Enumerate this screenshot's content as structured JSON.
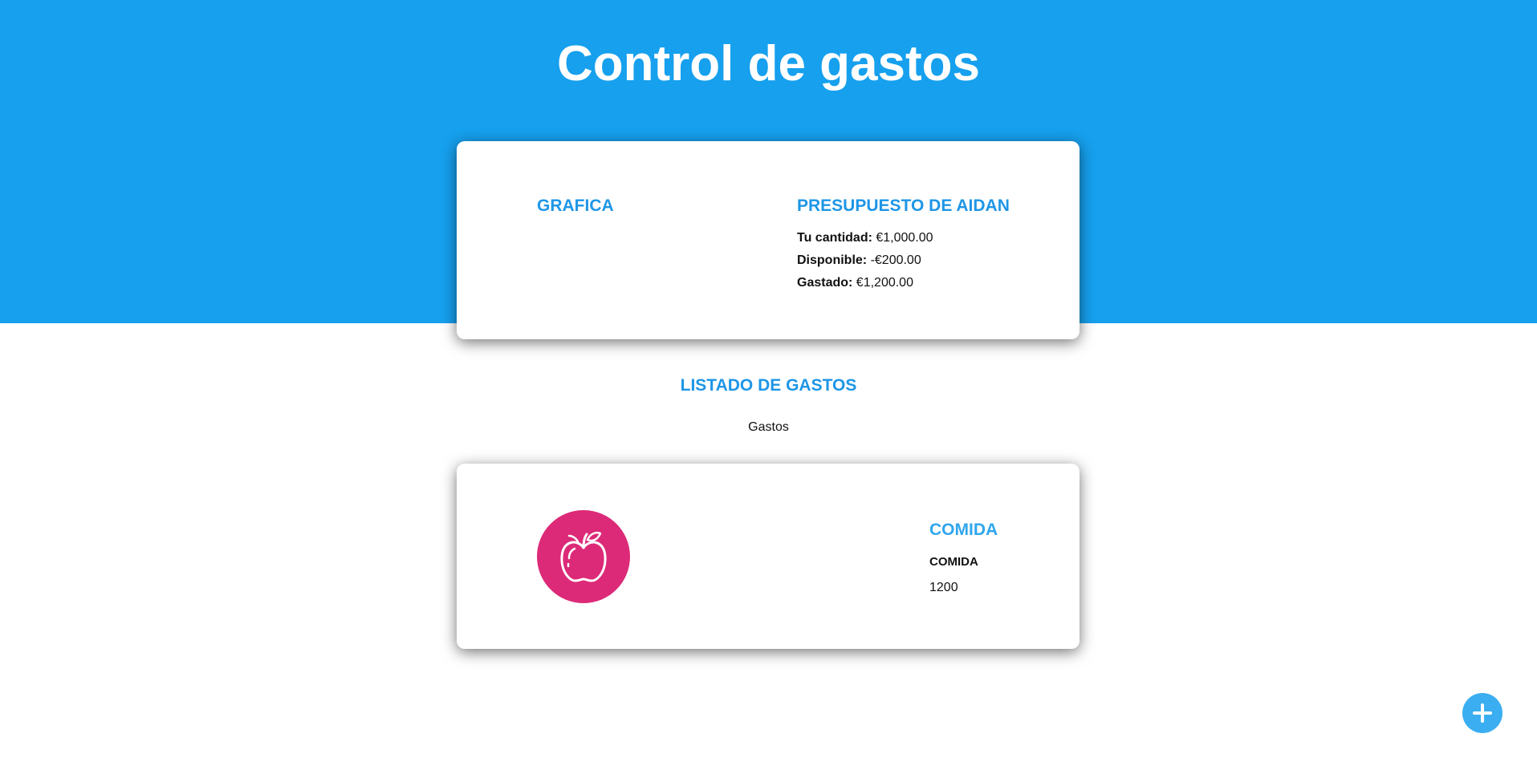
{
  "colors": {
    "header_background": "#16a0ee",
    "accent_heading": "#1e96e6",
    "category_icon_background": "#dc2a78",
    "add_button_background": "#3aaef0"
  },
  "header": {
    "title": "Control de gastos"
  },
  "budget_card": {
    "chart_heading": "GRAFICA",
    "budget_heading": "PRESUPUESTO DE AIDAN",
    "lines": [
      {
        "label": "Tu cantidad:",
        "value": "€1,000.00"
      },
      {
        "label": "Disponible:",
        "value": "-€200.00"
      },
      {
        "label": "Gastado:",
        "value": "€1,200.00"
      }
    ]
  },
  "expense_list": {
    "heading": "LISTADO DE GASTOS",
    "subtitle": "Gastos",
    "items": [
      {
        "icon": "apple-icon",
        "category": "COMIDA",
        "name": "COMIDA",
        "amount": "1200"
      }
    ]
  },
  "fab": {
    "icon": "plus-icon"
  }
}
